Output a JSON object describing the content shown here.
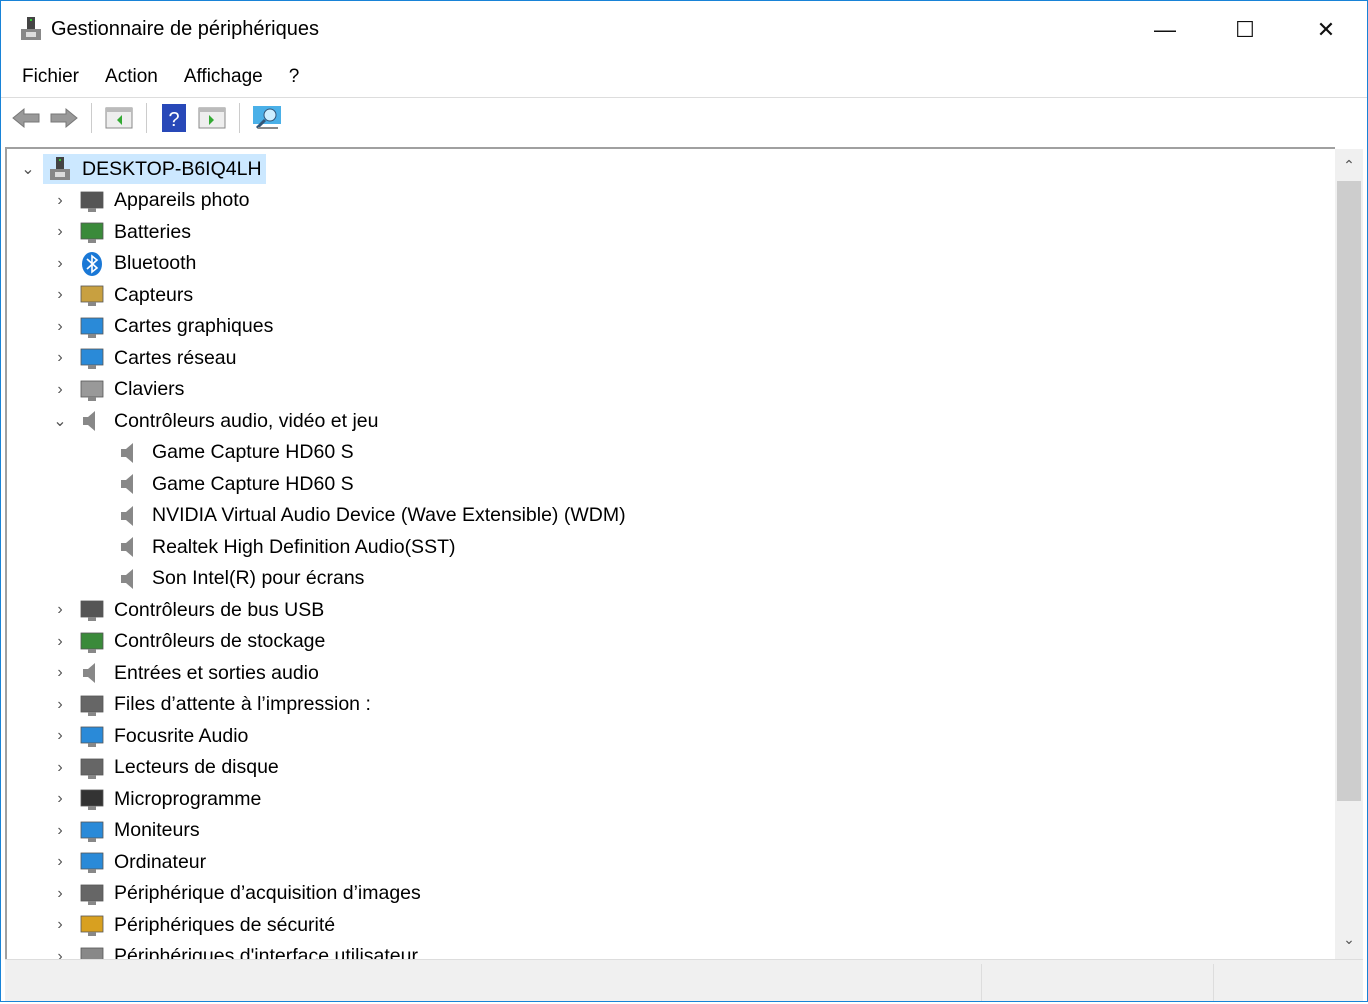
{
  "window": {
    "title": "Gestionnaire de périphériques",
    "minimize": "—",
    "maximize": "☐",
    "close": "✕"
  },
  "menu": [
    "Fichier",
    "Action",
    "Affichage",
    "?"
  ],
  "toolbar": {
    "icons": [
      "back-icon",
      "forward-icon",
      "show-hide-console-tree-icon",
      "help-icon",
      "show-hide-action-pane-icon",
      "scan-hardware-icon"
    ]
  },
  "tree": {
    "root": "DESKTOP-B6IQ4LH",
    "items": [
      {
        "label": "Appareils photo",
        "icon": "camera-icon",
        "color": "#555",
        "expanded": false,
        "level": 1
      },
      {
        "label": "Batteries",
        "icon": "battery-icon",
        "color": "#3a8a3a",
        "expanded": false,
        "level": 1
      },
      {
        "label": "Bluetooth",
        "icon": "bluetooth-icon",
        "color": "#1a78d6",
        "expanded": false,
        "level": 1
      },
      {
        "label": "Capteurs",
        "icon": "sensor-icon",
        "color": "#c8a040",
        "expanded": false,
        "level": 1
      },
      {
        "label": "Cartes graphiques",
        "icon": "display-adapter-icon",
        "color": "#2a8ad8",
        "expanded": false,
        "level": 1
      },
      {
        "label": "Cartes réseau",
        "icon": "network-adapter-icon",
        "color": "#2a8ad8",
        "expanded": false,
        "level": 1
      },
      {
        "label": "Claviers",
        "icon": "keyboard-icon",
        "color": "#999",
        "expanded": false,
        "level": 1
      },
      {
        "label": "Contrôleurs audio, vidéo et jeu",
        "icon": "speaker-icon",
        "color": "#888",
        "expanded": true,
        "level": 1
      },
      {
        "label": "Game Capture HD60 S",
        "icon": "speaker-icon",
        "color": "#888",
        "level": 2
      },
      {
        "label": "Game Capture HD60 S",
        "icon": "speaker-icon",
        "color": "#888",
        "level": 2
      },
      {
        "label": "NVIDIA Virtual Audio Device (Wave Extensible) (WDM)",
        "icon": "speaker-icon",
        "color": "#888",
        "level": 2
      },
      {
        "label": "Realtek High Definition Audio(SST)",
        "icon": "speaker-icon",
        "color": "#888",
        "level": 2
      },
      {
        "label": "Son Intel(R) pour écrans",
        "icon": "speaker-icon",
        "color": "#888",
        "level": 2
      },
      {
        "label": "Contrôleurs de bus USB",
        "icon": "usb-icon",
        "color": "#555",
        "expanded": false,
        "level": 1
      },
      {
        "label": "Contrôleurs de stockage",
        "icon": "storage-controller-icon",
        "color": "#3a8a3a",
        "expanded": false,
        "level": 1
      },
      {
        "label": "Entrées et sorties audio",
        "icon": "speaker-icon",
        "color": "#888",
        "expanded": false,
        "level": 1
      },
      {
        "label": "Files d’attente à l’impression :",
        "icon": "printer-icon",
        "color": "#666",
        "expanded": false,
        "level": 1
      },
      {
        "label": "Focusrite Audio",
        "icon": "network-adapter-icon",
        "color": "#2a8ad8",
        "expanded": false,
        "level": 1
      },
      {
        "label": "Lecteurs de disque",
        "icon": "disk-drive-icon",
        "color": "#666",
        "expanded": false,
        "level": 1
      },
      {
        "label": "Microprogramme",
        "icon": "firmware-icon",
        "color": "#333",
        "expanded": false,
        "level": 1
      },
      {
        "label": "Moniteurs",
        "icon": "monitor-icon",
        "color": "#2a8ad8",
        "expanded": false,
        "level": 1
      },
      {
        "label": "Ordinateur",
        "icon": "computer-icon",
        "color": "#2a8ad8",
        "expanded": false,
        "level": 1
      },
      {
        "label": "Périphérique d’acquisition d’images",
        "icon": "scanner-icon",
        "color": "#666",
        "expanded": false,
        "level": 1
      },
      {
        "label": "Périphériques de sécurité",
        "icon": "security-device-icon",
        "color": "#d8a020",
        "expanded": false,
        "level": 1
      },
      {
        "label": "Périphériques d'interface utilisateur",
        "icon": "hid-icon",
        "color": "#888",
        "expanded": false,
        "level": 1
      }
    ]
  }
}
